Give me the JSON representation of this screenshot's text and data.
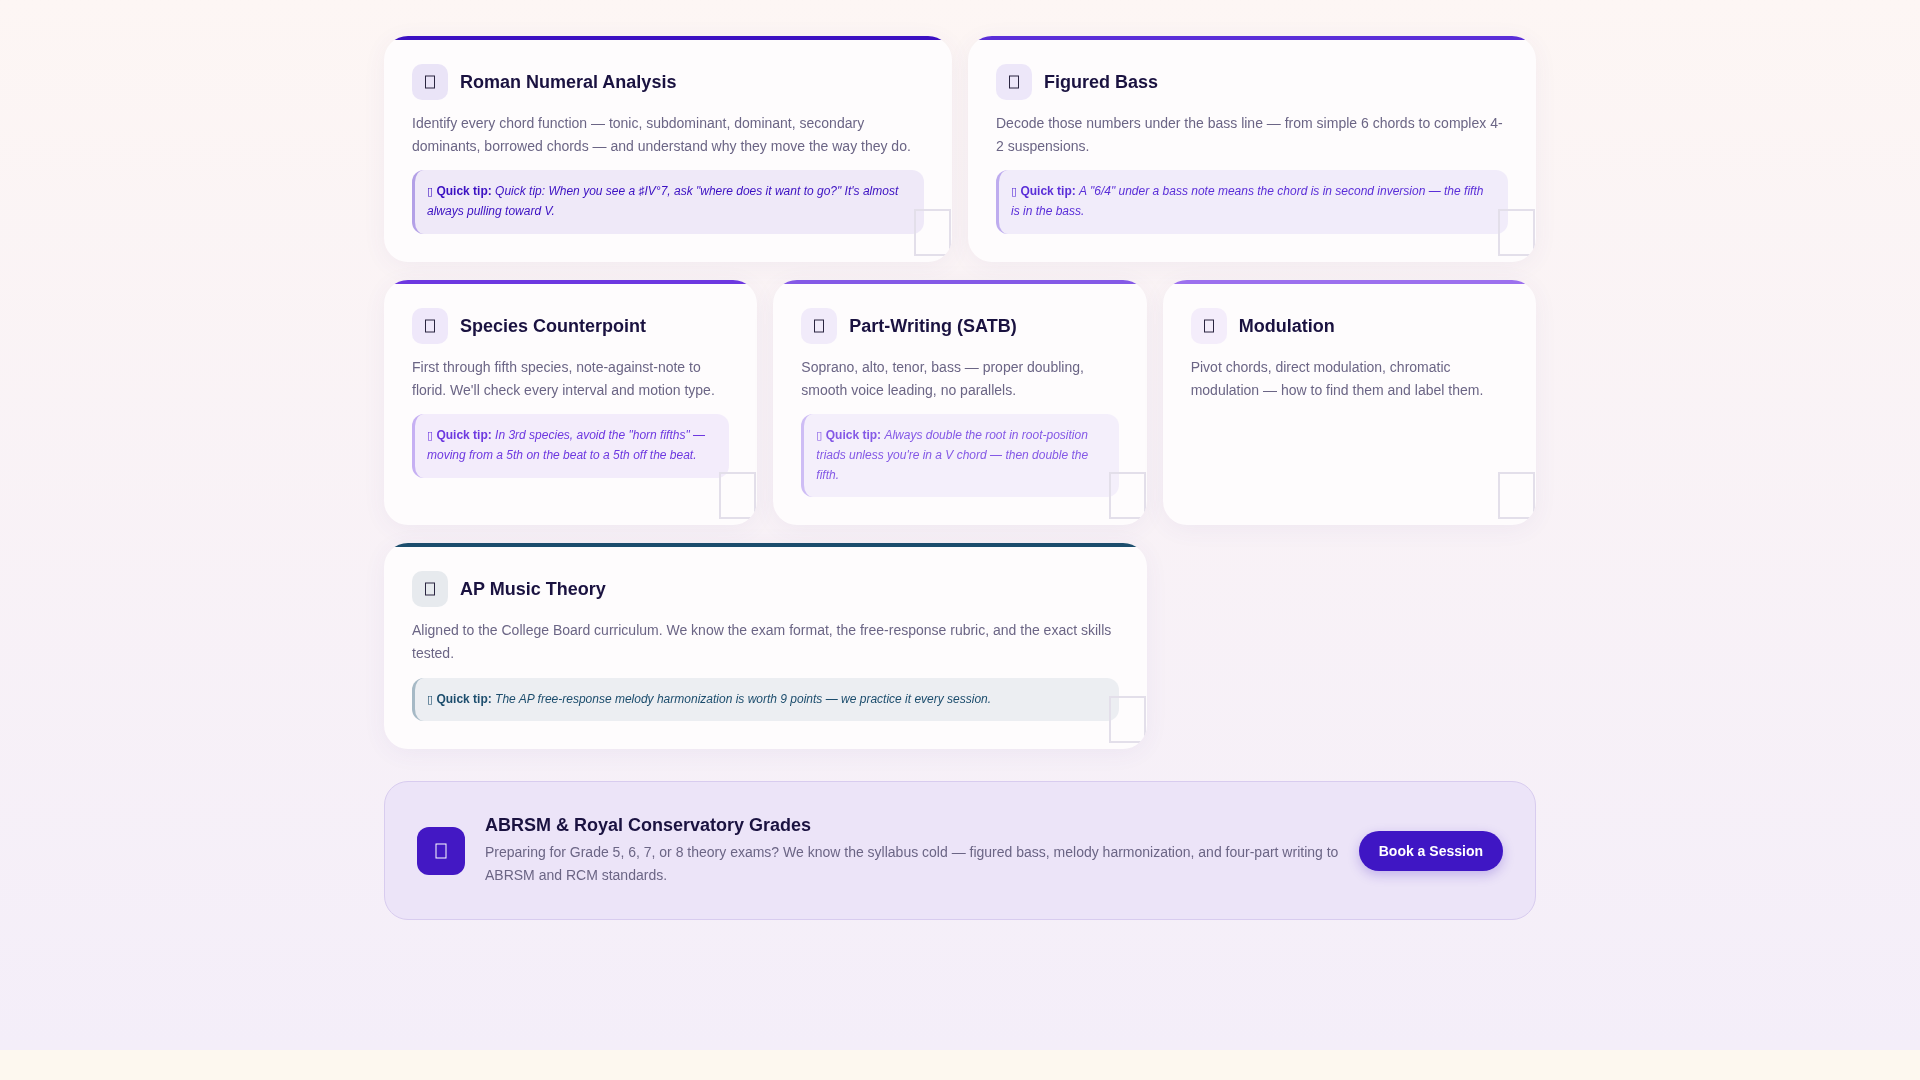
{
  "card_rows": [
    [
      {
        "title": "Roman Numeral Analysis",
        "color": "#3b10c2",
        "description": "Identify every chord function — tonic, subdominant, dominant, secondary dominants, borrowed chords — and understand why they move the way they do.",
        "tip": {
          "glyph": "▯",
          "label": "Quick tip:",
          "text": "Quick tip: When you see a ♯IV°7, ask \"where does it want to go?\" It's almost always pulling toward V."
        }
      },
      {
        "title": "Figured Bass",
        "color": "#5a2ed8",
        "description": "Decode those numbers under the bass line — from simple 6 chords to complex 4-2 suspensions.",
        "tip": {
          "glyph": "▯",
          "label": "Quick tip:",
          "text": "A \"6/4\" under a bass note means the chord is in second inversion — the fifth is in the bass."
        }
      }
    ],
    [
      {
        "title": "Species Counterpoint",
        "color": "#6d38e0",
        "description": "First through fifth species, note-against-note to florid. We'll check every interval and motion type.",
        "tip": {
          "glyph": "▯",
          "label": "Quick tip:",
          "text": "In 3rd species, avoid the \"horn fifths\" — moving from a 5th on the beat to a 5th off the beat."
        }
      },
      {
        "title": "Part-Writing (SATB)",
        "color": "#8459e6",
        "description": "Soprano, alto, tenor, bass — proper doubling, smooth voice leading, no parallels.",
        "tip": {
          "glyph": "▯",
          "label": "Quick tip:",
          "text": "Always double the root in root-position triads unless you're in a V chord — then double the fifth."
        }
      },
      {
        "title": "Modulation",
        "color": "#9c70ee",
        "description": "Pivot chords, direct modulation, chromatic modulation — how to find them and label them."
      }
    ],
    [
      {
        "title": "AP Music Theory",
        "color": "#1c4d6d",
        "description": "Aligned to the College Board curriculum. We know the exam format, the free-response rubric, and the exact skills tested.",
        "tip": {
          "glyph": "▯",
          "label": "Quick tip:",
          "text": "The AP free-response melody harmonization is worth 9 points — we practice it every session."
        }
      }
    ]
  ],
  "banner": {
    "title": "ABRSM & Royal Conservatory Grades",
    "description": "Preparing for Grade 5, 6, 7, or 8 theory exams? We know the syllabus cold — figured bass, melody harmonization, and four-part writing to ABRSM and RCM standards.",
    "button": "Book a Session"
  }
}
